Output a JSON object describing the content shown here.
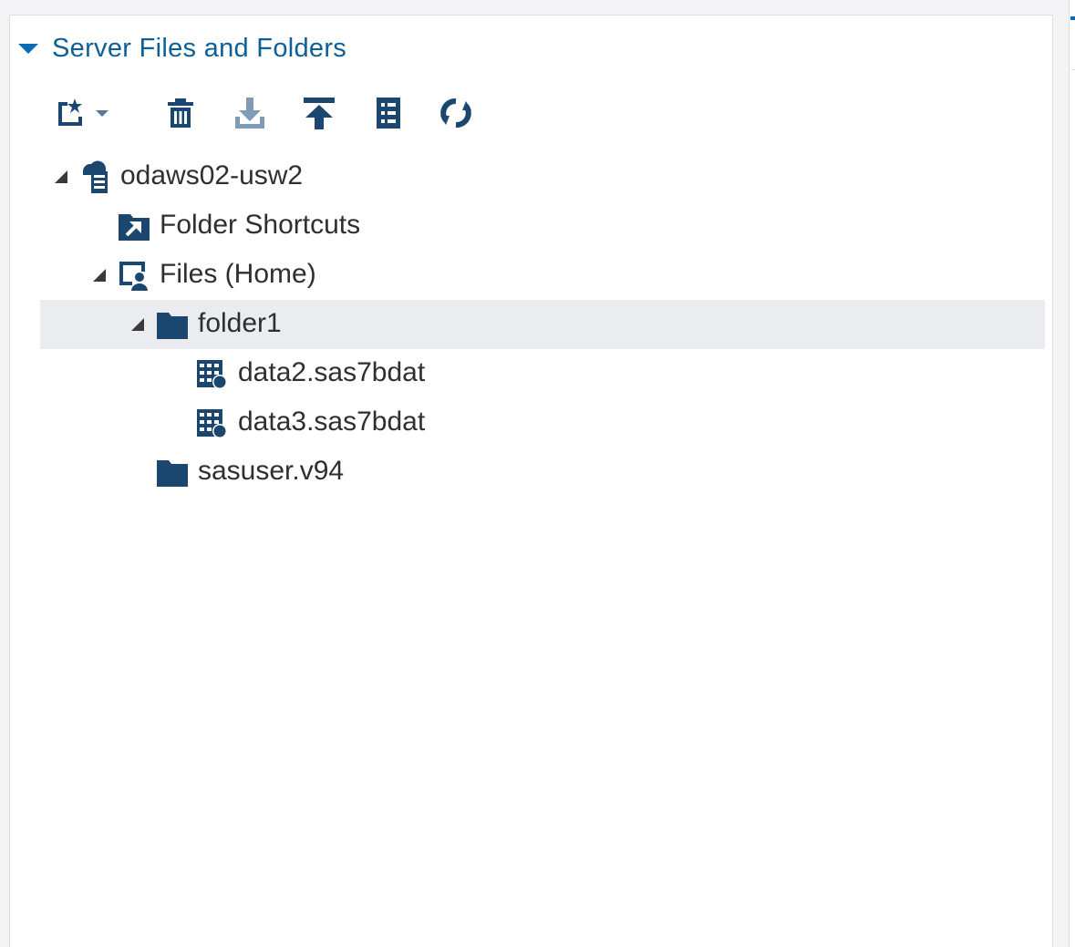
{
  "panel": {
    "title": "Server Files and Folders",
    "accent_color": "#0b6bb3",
    "icon_color": "#1b4670"
  },
  "toolbar": {
    "buttons": [
      {
        "name": "new-icon",
        "has_dropdown": true
      },
      {
        "name": "delete-icon"
      },
      {
        "name": "download-icon"
      },
      {
        "name": "upload-icon"
      },
      {
        "name": "properties-icon"
      },
      {
        "name": "refresh-icon"
      }
    ]
  },
  "tree": {
    "server": {
      "label": "odaws02-usw2",
      "icon": "server-icon",
      "expanded": true
    },
    "folder_shortcuts": {
      "label": "Folder Shortcuts",
      "icon": "folder-shortcut-icon"
    },
    "files_home": {
      "label": "Files (Home)",
      "icon": "home-files-icon",
      "expanded": true
    },
    "folder1": {
      "label": "folder1",
      "icon": "folder-icon",
      "expanded": true,
      "selected": true
    },
    "data2": {
      "label": "data2.sas7bdat",
      "icon": "dataset-icon"
    },
    "data3": {
      "label": "data3.sas7bdat",
      "icon": "dataset-icon"
    },
    "sasuser": {
      "label": "sasuser.v94",
      "icon": "folder-icon"
    }
  }
}
